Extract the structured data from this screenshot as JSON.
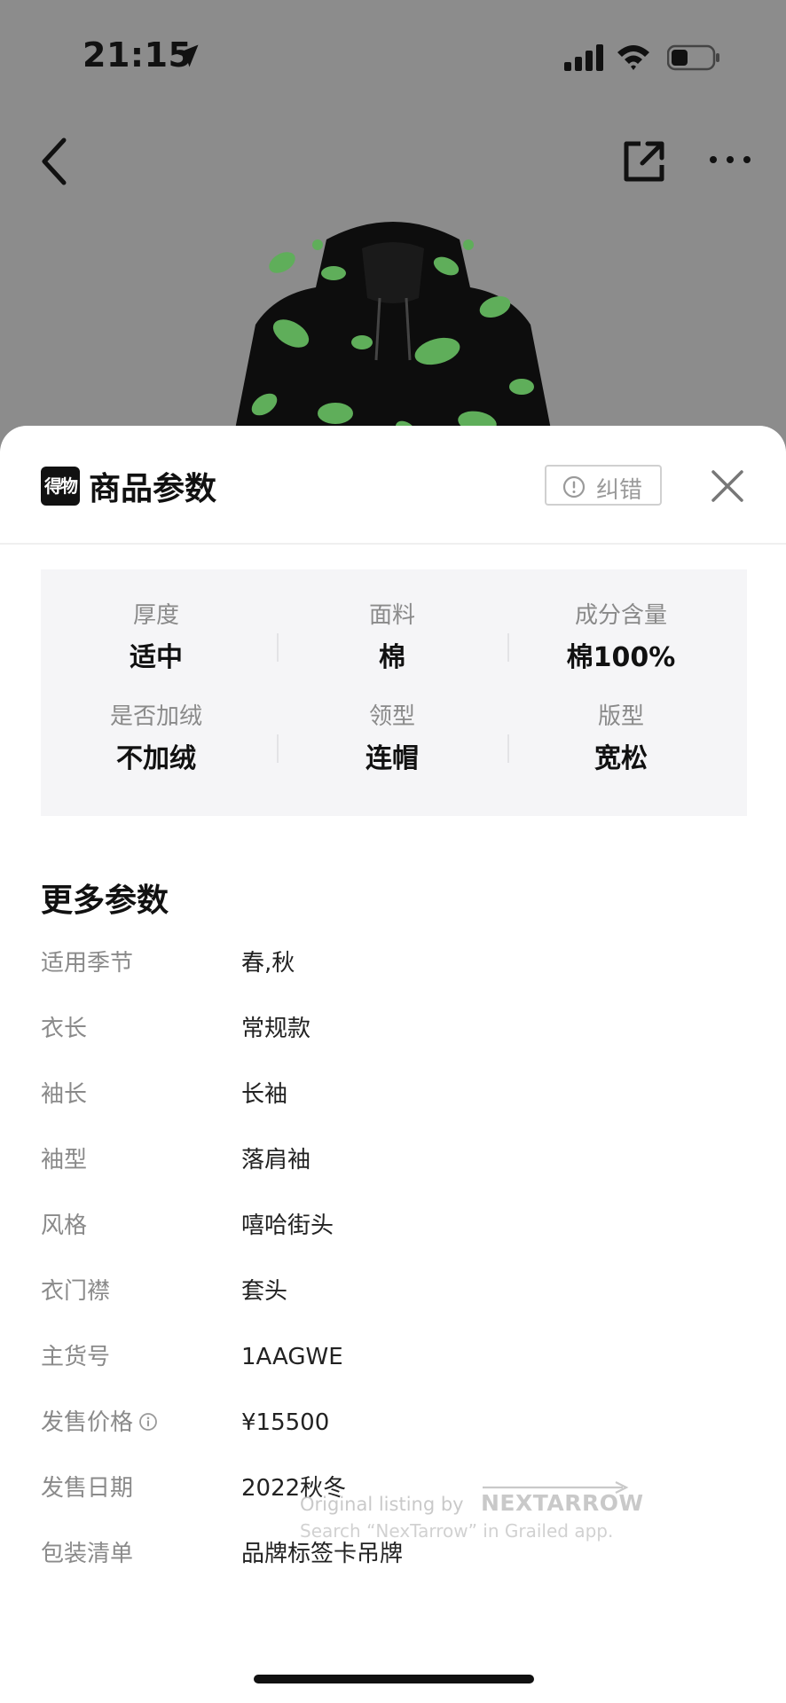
{
  "status_bar": {
    "time": "21:15"
  },
  "nav": {
    "icons": [
      "chevron-left-icon",
      "share-icon",
      "more-icon"
    ]
  },
  "sheet": {
    "title": "商品参数",
    "logo_text": "得物",
    "report_label": "纠错"
  },
  "key_params": [
    {
      "label": "厚度",
      "value": "适中"
    },
    {
      "label": "面料",
      "value": "棉"
    },
    {
      "label": "成分含量",
      "value": "棉100%"
    },
    {
      "label": "是否加绒",
      "value": "不加绒"
    },
    {
      "label": "领型",
      "value": "连帽"
    },
    {
      "label": "版型",
      "value": "宽松"
    }
  ],
  "more_params": {
    "title": "更多参数",
    "rows": [
      {
        "label": "适用季节",
        "value": "春,秋"
      },
      {
        "label": "衣长",
        "value": "常规款"
      },
      {
        "label": "袖长",
        "value": "长袖"
      },
      {
        "label": "袖型",
        "value": "落肩袖"
      },
      {
        "label": "风格",
        "value": "嘻哈街头"
      },
      {
        "label": "衣门襟",
        "value": "套头"
      },
      {
        "label": "主货号",
        "value": "1AAGWE"
      },
      {
        "label": "发售价格",
        "value": "¥15500"
      },
      {
        "label": "发售日期",
        "value": "2022秋冬"
      },
      {
        "label": "包装清单",
        "value": "品牌标签卡吊牌"
      }
    ]
  },
  "watermark": {
    "line1": "Original listing by",
    "brand": "NEXTARROW",
    "line2": "Search “NexTarrow” in Grailed app."
  },
  "colors": {
    "backdrop": "#8c8c8c",
    "hoodie_base": "#0d0d0d",
    "hoodie_print": "#5fae5a",
    "params_bg": "#f5f5f7"
  }
}
